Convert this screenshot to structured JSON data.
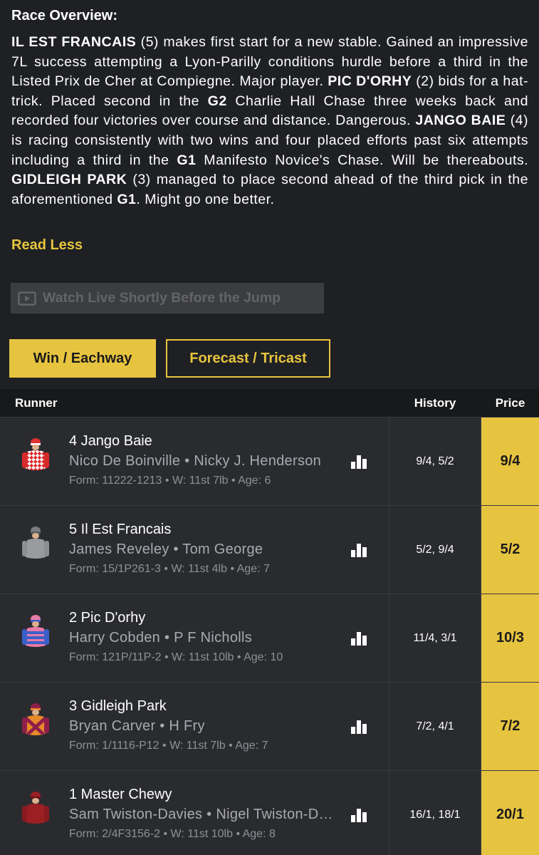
{
  "overview": {
    "title": "Race Overview:",
    "read_less": "Read Less"
  },
  "watch": {
    "label": "Watch Live Shortly Before the Jump"
  },
  "tabs": {
    "win": "Win / Eachway",
    "forecast": "Forecast / Tricast"
  },
  "table": {
    "headers": {
      "runner": "Runner",
      "history": "History",
      "price": "Price"
    },
    "rows": [
      {
        "name": "4 Jango Baie",
        "jockey_trainer": "Nico De Boinville • Nicky J. Henderson",
        "form": "Form: 11222-1213 • W: 11st 7lb • Age: 6",
        "history": "9/4, 5/2",
        "price": "9/4",
        "silk": "red-diamonds"
      },
      {
        "name": "5 Il Est Francais",
        "jockey_trainer": "James Reveley • Tom George",
        "form": "Form: 15/1P261-3 • W: 11st 4lb • Age: 7",
        "history": "5/2, 9/4",
        "price": "5/2",
        "silk": "grey"
      },
      {
        "name": "2 Pic D'orhy",
        "jockey_trainer": "Harry Cobden • P F Nicholls",
        "form": "Form: 121P/11P-2 • W: 11st 10lb • Age: 10",
        "history": "11/4, 3/1",
        "price": "10/3",
        "silk": "pink-blue-hoops"
      },
      {
        "name": "3 Gidleigh Park",
        "jockey_trainer": "Bryan Carver • H Fry",
        "form": "Form: 1/1116-P12 • W: 11st 7lb • Age: 7",
        "history": "7/2, 4/1",
        "price": "7/2",
        "silk": "maroon-orange"
      },
      {
        "name": "1 Master Chewy",
        "jockey_trainer": "Sam Twiston-Davies • Nigel Twiston-Davies",
        "form": "Form: 2/4F3156-2 • W: 11st 10lb • Age: 8",
        "history": "16/1, 18/1",
        "price": "20/1",
        "silk": "maroon"
      }
    ]
  },
  "colors": {
    "accent": "#e7c440",
    "background": "#1f2023",
    "row": "#2a2b2f"
  }
}
